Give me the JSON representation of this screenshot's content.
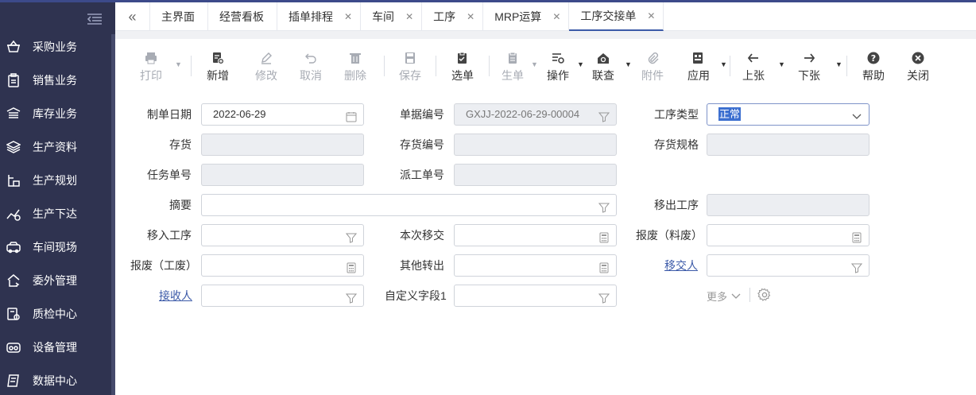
{
  "sidebar": {
    "items": [
      {
        "label": "采购业务",
        "icon": "basket-icon"
      },
      {
        "label": "销售业务",
        "icon": "clipboard-icon"
      },
      {
        "label": "库存业务",
        "icon": "warehouse-icon"
      },
      {
        "label": "生产资料",
        "icon": "layers-icon"
      },
      {
        "label": "生产规划",
        "icon": "plan-icon"
      },
      {
        "label": "生产下达",
        "icon": "chart-icon"
      },
      {
        "label": "车间现场",
        "icon": "vehicle-icon"
      },
      {
        "label": "委外管理",
        "icon": "outsource-icon"
      },
      {
        "label": "质检中心",
        "icon": "inspection-icon"
      },
      {
        "label": "设备管理",
        "icon": "device-icon"
      },
      {
        "label": "数据中心",
        "icon": "data-icon"
      }
    ]
  },
  "tabs": [
    {
      "label": "主界面",
      "closable": false
    },
    {
      "label": "经营看板",
      "closable": false
    },
    {
      "label": "插单排程",
      "closable": true
    },
    {
      "label": "车间",
      "closable": true
    },
    {
      "label": "工序",
      "closable": true
    },
    {
      "label": "MRP运算",
      "closable": true
    },
    {
      "label": "工序交接单",
      "closable": true,
      "active": true
    }
  ],
  "toolbar": {
    "print": "打印",
    "new": "新增",
    "edit": "修改",
    "cancel": "取消",
    "delete": "删除",
    "save": "保存",
    "select_order": "选单",
    "generate": "生单",
    "operate": "操作",
    "linked_query": "联查",
    "attachment": "附件",
    "apply": "应用",
    "prev": "上张",
    "next": "下张",
    "help": "帮助",
    "close": "关闭"
  },
  "form": {
    "date_label": "制单日期",
    "date_value": "2022-06-29",
    "doc_no_label": "单据编号",
    "doc_no_value": "GXJJ-2022-06-29-00004",
    "process_type_label": "工序类型",
    "process_type_value": "正常",
    "inventory_label": "存货",
    "inventory_code_label": "存货编号",
    "inventory_spec_label": "存货规格",
    "task_no_label": "任务单号",
    "dispatch_no_label": "派工单号",
    "summary_label": "摘要",
    "out_process_label": "移出工序",
    "in_process_label": "移入工序",
    "transfer_qty_label": "本次移交",
    "scrap_material_label": "报废（料废）",
    "scrap_work_label": "报废（工废）",
    "other_out_label": "其他转出",
    "handover_person_label": "移交人",
    "receiver_label": "接收人",
    "custom_field1_label": "自定义字段1",
    "more_label": "更多"
  },
  "colors": {
    "sidebar_bg": "#2f3350",
    "accent": "#3c5aa8",
    "readonly_bg": "#eceef2"
  }
}
